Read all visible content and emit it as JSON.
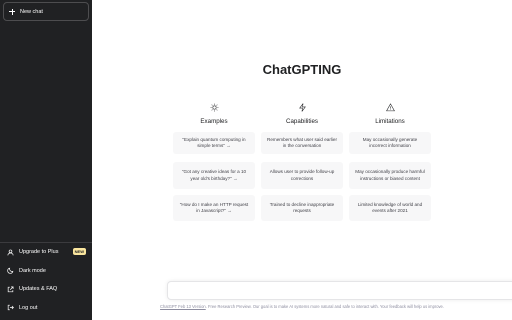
{
  "app": {
    "title": "ChatGPTING"
  },
  "sidebar": {
    "new_chat": "New chat",
    "bottom_items": [
      {
        "label": "Upgrade to Plus",
        "icon": "user-icon",
        "badge": "NEW"
      },
      {
        "label": "Dark mode",
        "icon": "moon-icon"
      },
      {
        "label": "Updates & FAQ",
        "icon": "external-link-icon"
      },
      {
        "label": "Log out",
        "icon": "logout-icon"
      }
    ]
  },
  "columns": [
    {
      "heading": "Examples",
      "icon": "sun-icon",
      "cards": [
        "\"Explain quantum computing in simple terms\" →",
        "\"Got any creative ideas for a 10 year old's birthday?\" →",
        "\"How do I make an HTTP request in Javascript?\" →"
      ]
    },
    {
      "heading": "Capabilities",
      "icon": "lightning-icon",
      "cards": [
        "Remembers what user said earlier in the conversation",
        "Allows user to provide follow-up corrections",
        "Trained to decline inappropriate requests"
      ]
    },
    {
      "heading": "Limitations",
      "icon": "warning-icon",
      "cards": [
        "May occasionally generate incorrect information",
        "May occasionally produce harmful instructions or biased content",
        "Limited knowledge of world and events after 2021"
      ]
    }
  ],
  "input": {
    "placeholder": "",
    "value": ""
  },
  "footer": {
    "link_text": "ChatGPT Feb 13 Version",
    "text": ". Free Research Preview. Our goal is to make AI systems more natural and safe to interact with. Your feedback will help us improve."
  },
  "colors": {
    "sidebar_bg": "#202123",
    "card_bg": "#f7f7f8",
    "badge_bg": "#fae69e"
  }
}
